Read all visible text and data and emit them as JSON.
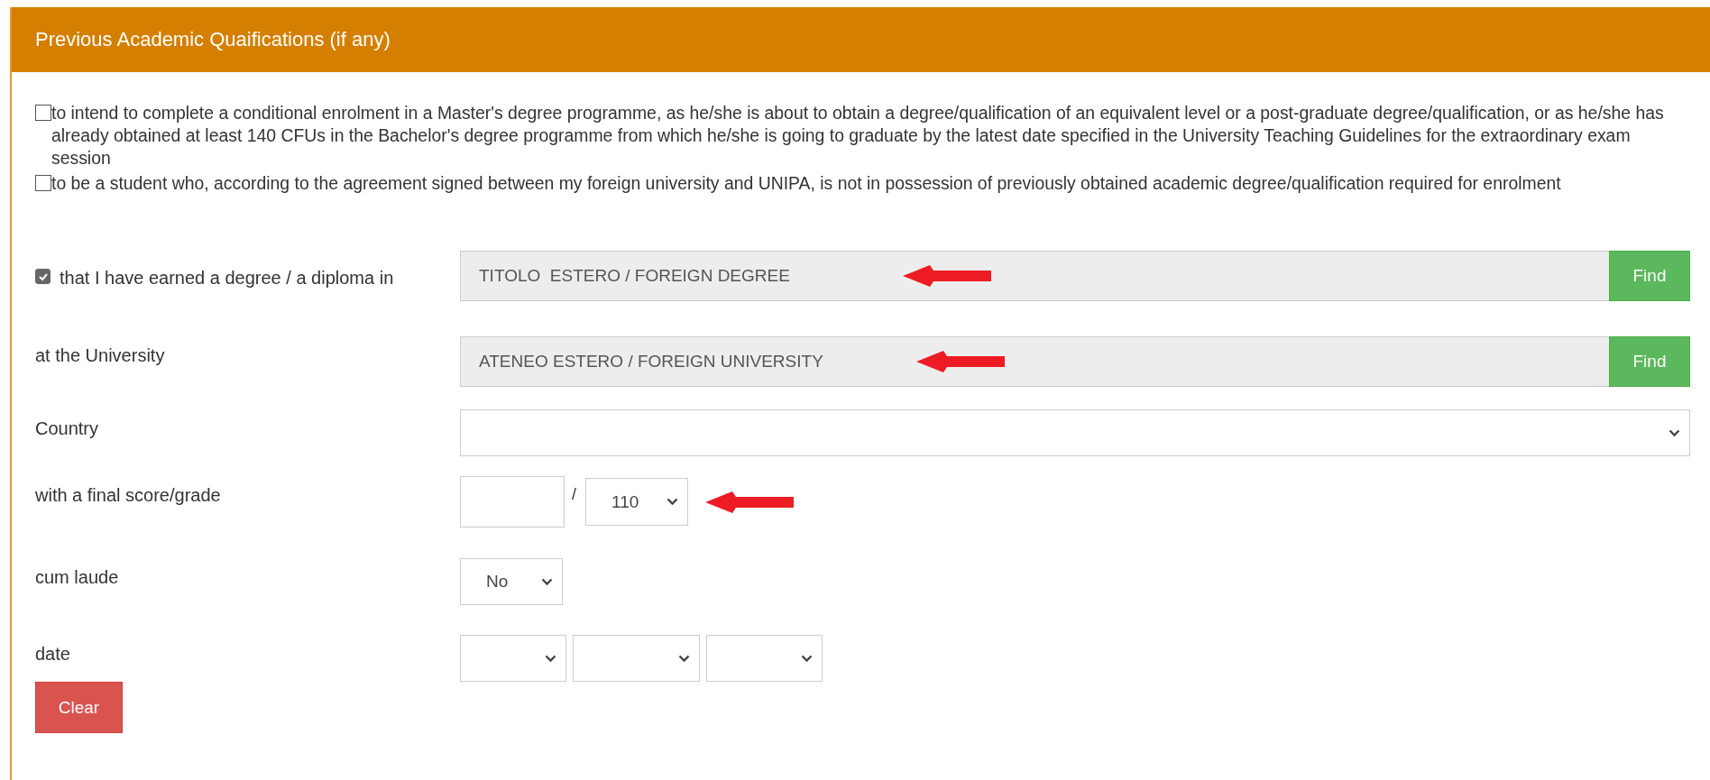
{
  "panel": {
    "title": "Previous Academic Quaifications (if any)"
  },
  "declarations": [
    {
      "text": "to intend to complete a conditional enrolment in a Master's degree programme, as he/she is about to obtain a degree/qualification of an equivalent level or a post-graduate degree/qualification, or as he/she has already obtained at least 140 CFUs in the Bachelor's degree programme from which he/she is going to graduate by the latest date specified in the University Teaching Guidelines for the extraordinary exam session",
      "checked": false
    },
    {
      "text": "to be a student who, according to the agreement signed between my foreign university and UNIPA, is not in possession of previously obtained academic degree/qualification required for enrolment",
      "checked": false
    }
  ],
  "degree": {
    "label": "that I have earned a degree / a diploma in",
    "checked": true,
    "value": "TITOLO  ESTERO / FOREIGN DEGREE",
    "button": "Find"
  },
  "university": {
    "label": "at the University",
    "value": "ATENEO ESTERO / FOREIGN UNIVERSITY",
    "button": "Find"
  },
  "country": {
    "label": "Country"
  },
  "score": {
    "label": "with a final score/grade",
    "separator": "/",
    "max": "110"
  },
  "cum_laude": {
    "label": "cum laude",
    "value": "No"
  },
  "date": {
    "label": "date"
  },
  "clear_button": "Clear"
}
